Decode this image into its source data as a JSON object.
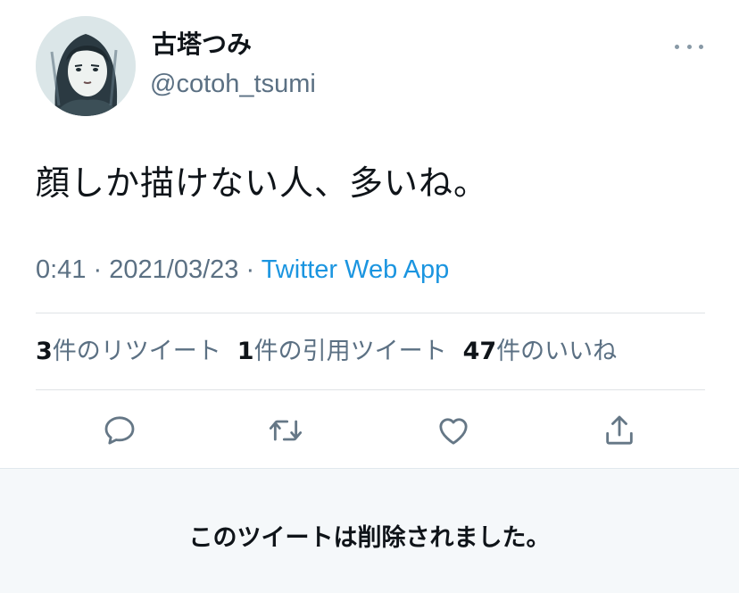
{
  "author": {
    "display_name": "古塔つみ",
    "handle": "@cotoh_tsumi",
    "avatar_icon": "portrait-illustration"
  },
  "tweet": {
    "text": "顔しか描けない人、多いね。",
    "time": "0:41",
    "date": "2021/03/23",
    "separator": "·",
    "source": "Twitter Web App"
  },
  "stats": {
    "retweets_count": "3",
    "retweets_label": "件のリツイート",
    "quotes_count": "1",
    "quotes_label": "件の引用ツイート",
    "likes_count": "47",
    "likes_label": "件のいいね"
  },
  "actions": {
    "reply_icon": "reply-icon",
    "retweet_icon": "retweet-icon",
    "like_icon": "heart-icon",
    "share_icon": "share-icon"
  },
  "notice": {
    "deleted_text": "このツイートは削除されました。"
  },
  "colors": {
    "text_primary": "#0f1419",
    "text_secondary": "#5b7083",
    "link": "#1b95e0",
    "icon": "#657786",
    "divider": "#dfe3e6",
    "notice_bg": "#f5f8fa"
  }
}
